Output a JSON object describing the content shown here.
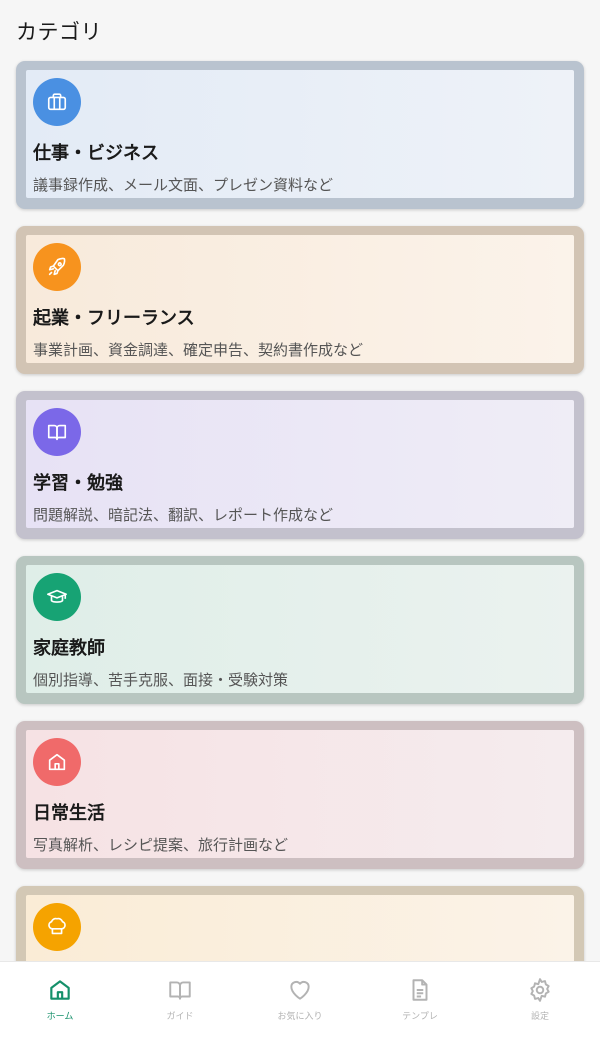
{
  "header": {
    "title": "カテゴリ"
  },
  "categories": [
    {
      "title": "仕事・ビジネス",
      "description": "議事録作成、メール文面、プレゼン資料など",
      "icon": "briefcase-icon",
      "color": "#4a90e2"
    },
    {
      "title": "起業・フリーランス",
      "description": "事業計画、資金調達、確定申告、契約書作成など",
      "icon": "rocket-icon",
      "color": "#f7931e"
    },
    {
      "title": "学習・勉強",
      "description": "問題解説、暗記法、翻訳、レポート作成など",
      "icon": "book-open-icon",
      "color": "#7b68e8"
    },
    {
      "title": "家庭教師",
      "description": "個別指導、苦手克服、面接・受験対策",
      "icon": "graduation-cap-icon",
      "color": "#17a374"
    },
    {
      "title": "日常生活",
      "description": "写真解析、レシピ提案、旅行計画など",
      "icon": "home-icon",
      "color": "#f06a6a"
    },
    {
      "title": "",
      "description": "",
      "icon": "chef-hat-icon",
      "color": "#f5a300"
    }
  ],
  "tabbar": {
    "active_color": "#15906a",
    "inactive_color": "#b3b3b3",
    "items": [
      {
        "label": "ホーム",
        "icon": "home-icon",
        "active": true
      },
      {
        "label": "ガイド",
        "icon": "book-open-icon",
        "active": false
      },
      {
        "label": "お気に入り",
        "icon": "heart-icon",
        "active": false
      },
      {
        "label": "テンプレ",
        "icon": "document-icon",
        "active": false
      },
      {
        "label": "設定",
        "icon": "gear-icon",
        "active": false
      }
    ]
  }
}
